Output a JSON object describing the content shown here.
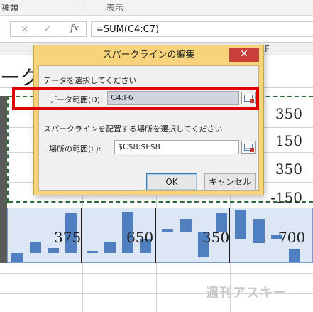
{
  "ribbon": {
    "group1": "種類",
    "group2": "表示"
  },
  "formula_bar": {
    "cancel_icon": "×",
    "confirm_icon": "✓",
    "fx_label": "fx",
    "formula": "=SUM(C4:C7)"
  },
  "sheet": {
    "col_letter_f": "F",
    "title_fragment": "ーク",
    "values": [
      "350",
      "150",
      "350",
      "-150"
    ],
    "spark_values": [
      "375",
      "650",
      "350",
      "700"
    ]
  },
  "dialog": {
    "title": "スパークラインの編集",
    "help": "?",
    "close": "✕",
    "data_section": "データを選択してください",
    "data_range_label": "データ範囲(D):",
    "data_range_value": "C4:F6",
    "location_section": "スパークラインを配置する場所を選択してください",
    "location_label": "場所の範囲(L):",
    "location_value": "$C$8:$F$8",
    "ok": "OK",
    "cancel": "キャンセル"
  },
  "watermark": "週刊アスキー",
  "colors": {
    "sparkline_bar": "#4f7fc1",
    "dialog_frame": "#f7d47c",
    "highlight": "#e00000"
  }
}
